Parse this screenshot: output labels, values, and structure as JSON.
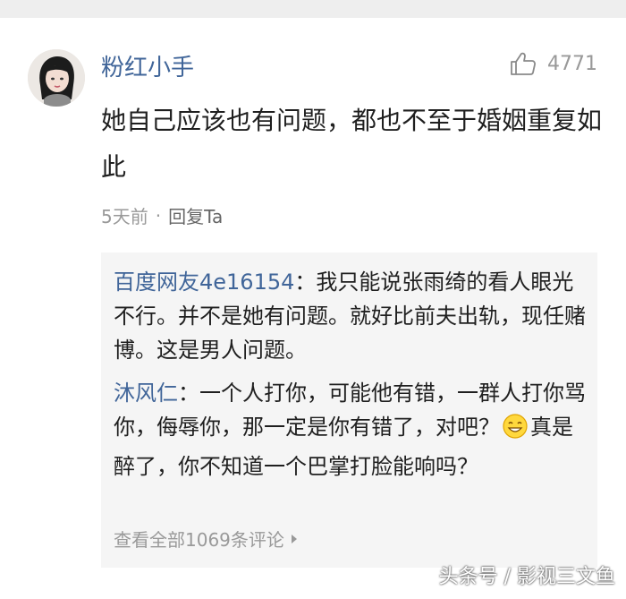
{
  "comment": {
    "author": "粉红小手",
    "likes": "4771",
    "text": "她自己应该也有问题，都也不至于婚姻重复如此",
    "time": "5天前",
    "separator": "·",
    "reply_label": "回复Ta"
  },
  "replies": [
    {
      "name": "百度网友4e16154",
      "colon": "：",
      "text": "我只能说张雨绮的看人眼光不行。并不是她有问题。就好比前夫出轨，现任赌博。这是男人问题。"
    },
    {
      "name": "沐风仁",
      "colon": "：",
      "text_before": "一个人打你，可能他有错，一群人打你骂你，侮辱你，那一定是你有错了，对吧？",
      "emoji": "smile-emoji",
      "text_after": "真是醉了，你不知道一个巴掌打脸能响吗？"
    }
  ],
  "view_all": "查看全部1069条评论",
  "watermark": "头条号 / 影视三文鱼",
  "colors": {
    "name_blue": "#406599",
    "muted_gray": "#999999",
    "reply_bg": "#f5f5f5"
  }
}
